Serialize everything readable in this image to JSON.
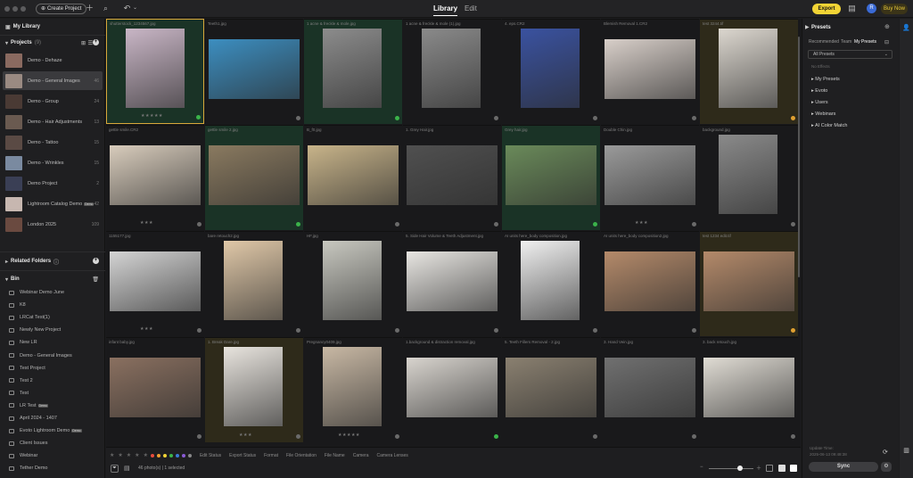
{
  "topbar": {
    "create_project": "Create Project",
    "tab_library": "Library",
    "tab_edit": "Edit",
    "export": "Export",
    "avatar": "R",
    "buy_now": "Buy Now"
  },
  "sidebar": {
    "my_library": "My Library",
    "projects_label": "Projects",
    "projects_count": "(9)",
    "projects": [
      {
        "name": "Demo - Dehaze",
        "count": "",
        "color": "#8a6a60"
      },
      {
        "name": "Demo - General Images",
        "count": "46",
        "color": "#9a8a82"
      },
      {
        "name": "Demo - Group",
        "count": "24",
        "color": "#4a3a34"
      },
      {
        "name": "Demo - Hair Adjustments",
        "count": "13",
        "color": "#6a5a50"
      },
      {
        "name": "Demo - Tattoo",
        "count": "15",
        "color": "#5a4a44"
      },
      {
        "name": "Demo - Wrinkles",
        "count": "15",
        "color": "#7a8aa0"
      },
      {
        "name": "Demo Project",
        "count": "2",
        "color": "#3a3f55"
      },
      {
        "name": "Lightroom Catalog Demo",
        "count": "42",
        "color": "#c7b7b0",
        "tag": "Demo"
      },
      {
        "name": "London 2025",
        "count": "109",
        "color": "#6a4a40"
      }
    ],
    "related_folders": "Related Folders",
    "bin_label": "Bin",
    "bin_items": [
      {
        "name": "Webinar Demo June"
      },
      {
        "name": "K8"
      },
      {
        "name": "LRCat Test(1)"
      },
      {
        "name": "Newly New Project"
      },
      {
        "name": "New LR"
      },
      {
        "name": "Demo - General Images"
      },
      {
        "name": "Test Project"
      },
      {
        "name": "Test 2"
      },
      {
        "name": "Test"
      },
      {
        "name": "LR Test",
        "tag": "Demo"
      },
      {
        "name": "April 2024 - 1407"
      },
      {
        "name": "Evoto Lightroom Demo",
        "tag": "Demo"
      },
      {
        "name": "Client Issues"
      },
      {
        "name": "Webinar"
      },
      {
        "name": "Tether Demo"
      }
    ]
  },
  "grid": {
    "items": [
      {
        "name": "shutterstock_1234567.jpg",
        "stars": "★★★★★",
        "dot": "#3bb34a",
        "bg": "#1a3326",
        "photo": "#c9b6c6",
        "sel": true
      },
      {
        "name": "Teeth1.jpg",
        "stars": "",
        "dot": "#6a6a6a",
        "bg": "#19191b",
        "photo": "#3c8ec0"
      },
      {
        "name": "1 acne & freckle & mole.jpg",
        "stars": "",
        "dot": "#3bb34a",
        "bg": "#1a3326",
        "photo": "#8c8c8c"
      },
      {
        "name": "1 acne & freckle & mole (1).jpg",
        "stars": "",
        "dot": "#6a6a6a",
        "bg": "#19191b",
        "photo": "#8a8a8a"
      },
      {
        "name": "4. eps.CR2",
        "stars": "",
        "dot": "#6a6a6a",
        "bg": "#19191b",
        "photo": "#3a52a0"
      },
      {
        "name": "Blemish Removal 1.CR2",
        "stars": "",
        "dot": "#6a6a6a",
        "bg": "#19191b",
        "photo": "#d8cfc9"
      },
      {
        "name": "test 3244.tif",
        "stars": "",
        "dot": "#e0a030",
        "bg": "#2e2a1a",
        "photo": "#dcd7cf"
      },
      {
        "name": "gettle smile.CR2",
        "stars": "★★★",
        "dot": "#6a6a6a",
        "bg": "#19191b",
        "photo": "#d8ccbc"
      },
      {
        "name": "gettle smile 2.jpg",
        "stars": "",
        "dot": "#3bb34a",
        "bg": "#1a3326",
        "photo": "#8a7a60"
      },
      {
        "name": "B_f0.jpg",
        "stars": "",
        "dot": "#6a6a6a",
        "bg": "#19191b",
        "photo": "#c8b48a"
      },
      {
        "name": "1. Grey Hair.jpg",
        "stars": "",
        "dot": "#6a6a6a",
        "bg": "#19191b",
        "photo": "#505050"
      },
      {
        "name": "Grey hair.jpg",
        "stars": "",
        "dot": "#3bb34a",
        "bg": "#1a3326",
        "photo": "#6a8a5a"
      },
      {
        "name": "Double Chin.jpg",
        "stars": "★★★",
        "dot": "#6a6a6a",
        "bg": "#19191b",
        "photo": "#9a9a9a"
      },
      {
        "name": "background.jpg",
        "stars": "",
        "dot": "#6a6a6a",
        "bg": "#19191b",
        "photo": "#8a8a8a"
      },
      {
        "name": "1155177.jpg",
        "stars": "★★★",
        "dot": "#6a6a6a",
        "bg": "#19191b",
        "photo": "#d4d4d4"
      },
      {
        "name": "bare retouch2.jpg",
        "stars": "",
        "dot": "#6a6a6a",
        "bg": "#19191b",
        "photo": "#e0c8a8"
      },
      {
        "name": "HF.jpg",
        "stars": "",
        "dot": "#6a6a6a",
        "bg": "#19191b",
        "photo": "#c8c8c0"
      },
      {
        "name": "5. Side Hair Volume & Teeth Adjustment.jpg",
        "stars": "",
        "dot": "#6a6a6a",
        "bg": "#19191b",
        "photo": "#e8e6e2"
      },
      {
        "name": "AI units here_body composition.jpg",
        "stars": "",
        "dot": "#6a6a6a",
        "bg": "#19191b",
        "photo": "#f0f0f0"
      },
      {
        "name": "AI units here_body composition2.jpg",
        "stars": "",
        "dot": "#6a6a6a",
        "bg": "#19191b",
        "photo": "#b48a6a"
      },
      {
        "name": "test 1234 edit.tif",
        "stars": "",
        "dot": "#e0a030",
        "bg": "#2e2a1a",
        "photo": "#b48a6a"
      },
      {
        "name": "infant baby.jpg",
        "stars": "",
        "dot": "#6a6a6a",
        "bg": "#19191b",
        "photo": "#8a7060"
      },
      {
        "name": "1. Break Dare.jpg",
        "stars": "★★★",
        "dot": "#6a6a6a",
        "bg": "#2e2a1a",
        "photo": "#e8e4de"
      },
      {
        "name": "Pregnancy0409.jpg",
        "stars": "★★★★★",
        "dot": "#6a6a6a",
        "bg": "#19191b",
        "photo": "#c8b8a4"
      },
      {
        "name": "1.background & distraction removal.jpg",
        "stars": "",
        "dot": "#3bb34a",
        "bg": "#19191b",
        "photo": "#d8d4ce"
      },
      {
        "name": "5. Teeth Fillers Removal - 2.jpg",
        "stars": "",
        "dot": "#6a6a6a",
        "bg": "#19191b",
        "photo": "#8a8070"
      },
      {
        "name": "3. Hand Vein.jpg",
        "stars": "",
        "dot": "#6a6a6a",
        "bg": "#19191b",
        "photo": "#707070"
      },
      {
        "name": "3. back retouch.jpg",
        "stars": "",
        "dot": "#6a6a6a",
        "bg": "#19191b",
        "photo": "#e0dcd4"
      }
    ]
  },
  "bottombar": {
    "filters": [
      "Edit Status",
      "Export Status",
      "Format",
      "File Orientation",
      "File Name",
      "Camera",
      "Camera Lenses"
    ],
    "count_text": "46 photo(s) | 1 selected"
  },
  "rightpanel": {
    "title": "Presets",
    "tabs": [
      "Recommended",
      "Team",
      "My Presets"
    ],
    "dropdown": "All Presets",
    "no_effects": "No Effects",
    "items": [
      "My Presets",
      "Evoto",
      "Users",
      "Webinars",
      "AI Color Match"
    ],
    "update_time": "Update Time:",
    "update_value": "2025-06-13 09:48:38",
    "sync": "Sync"
  }
}
